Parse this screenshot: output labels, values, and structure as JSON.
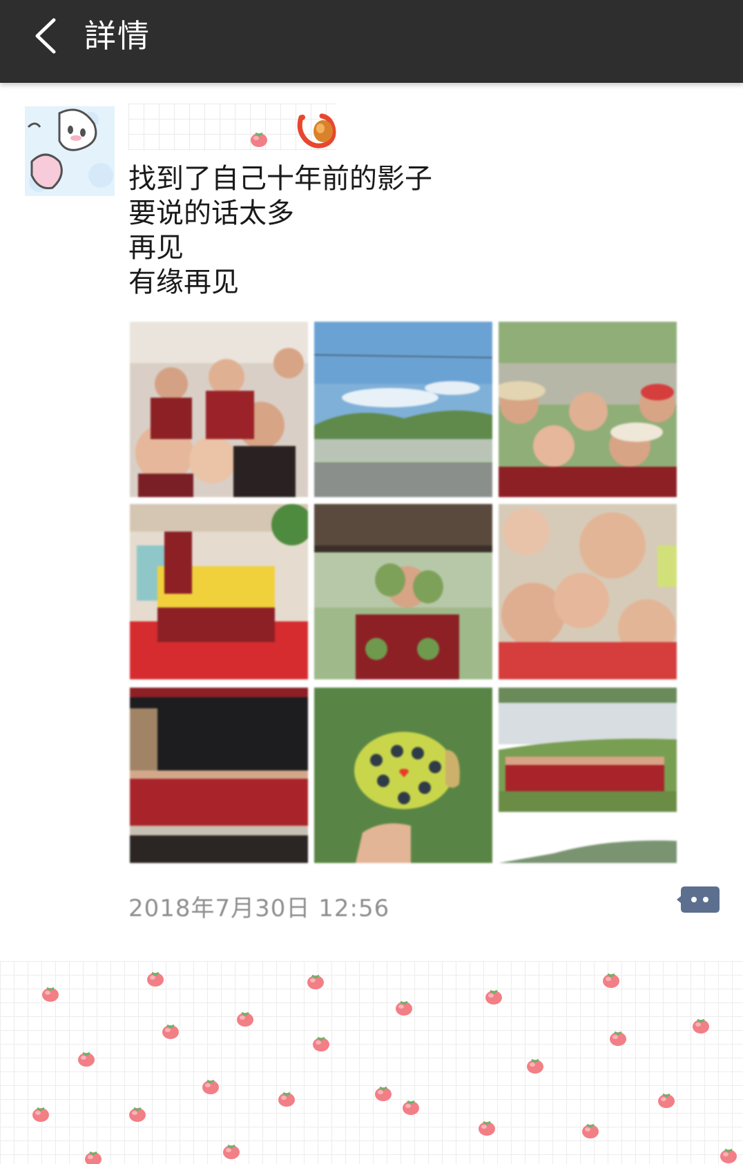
{
  "header": {
    "back_icon": "chevron-left-icon",
    "title": "詳情",
    "background_color": "#2e2e2e"
  },
  "post": {
    "avatar_icon": "cartoon-avatar",
    "sticker_icon": "shrimp-sticker",
    "text_lines": [
      "找到了自己十年前的影子",
      "要说的话太多",
      "再见",
      "有缘再见"
    ],
    "photos": [
      {
        "label": "group selfie in red shirts"
      },
      {
        "label": "field and mountains landscape"
      },
      {
        "label": "kids selfie by the river"
      },
      {
        "label": "group photo on red stage"
      },
      {
        "label": "boy holding lotus pods"
      },
      {
        "label": "close-up kids selfie"
      },
      {
        "label": "night group photo"
      },
      {
        "label": "lotus seed pod with heart"
      },
      {
        "label": "group photo in the field"
      }
    ],
    "timestamp": "2018年7月30日 12:56",
    "comment_icon": "comment-bubble-icon"
  },
  "footer": {
    "pattern_icon": "peach-grid-pattern",
    "accent_color": "#f27f86"
  }
}
